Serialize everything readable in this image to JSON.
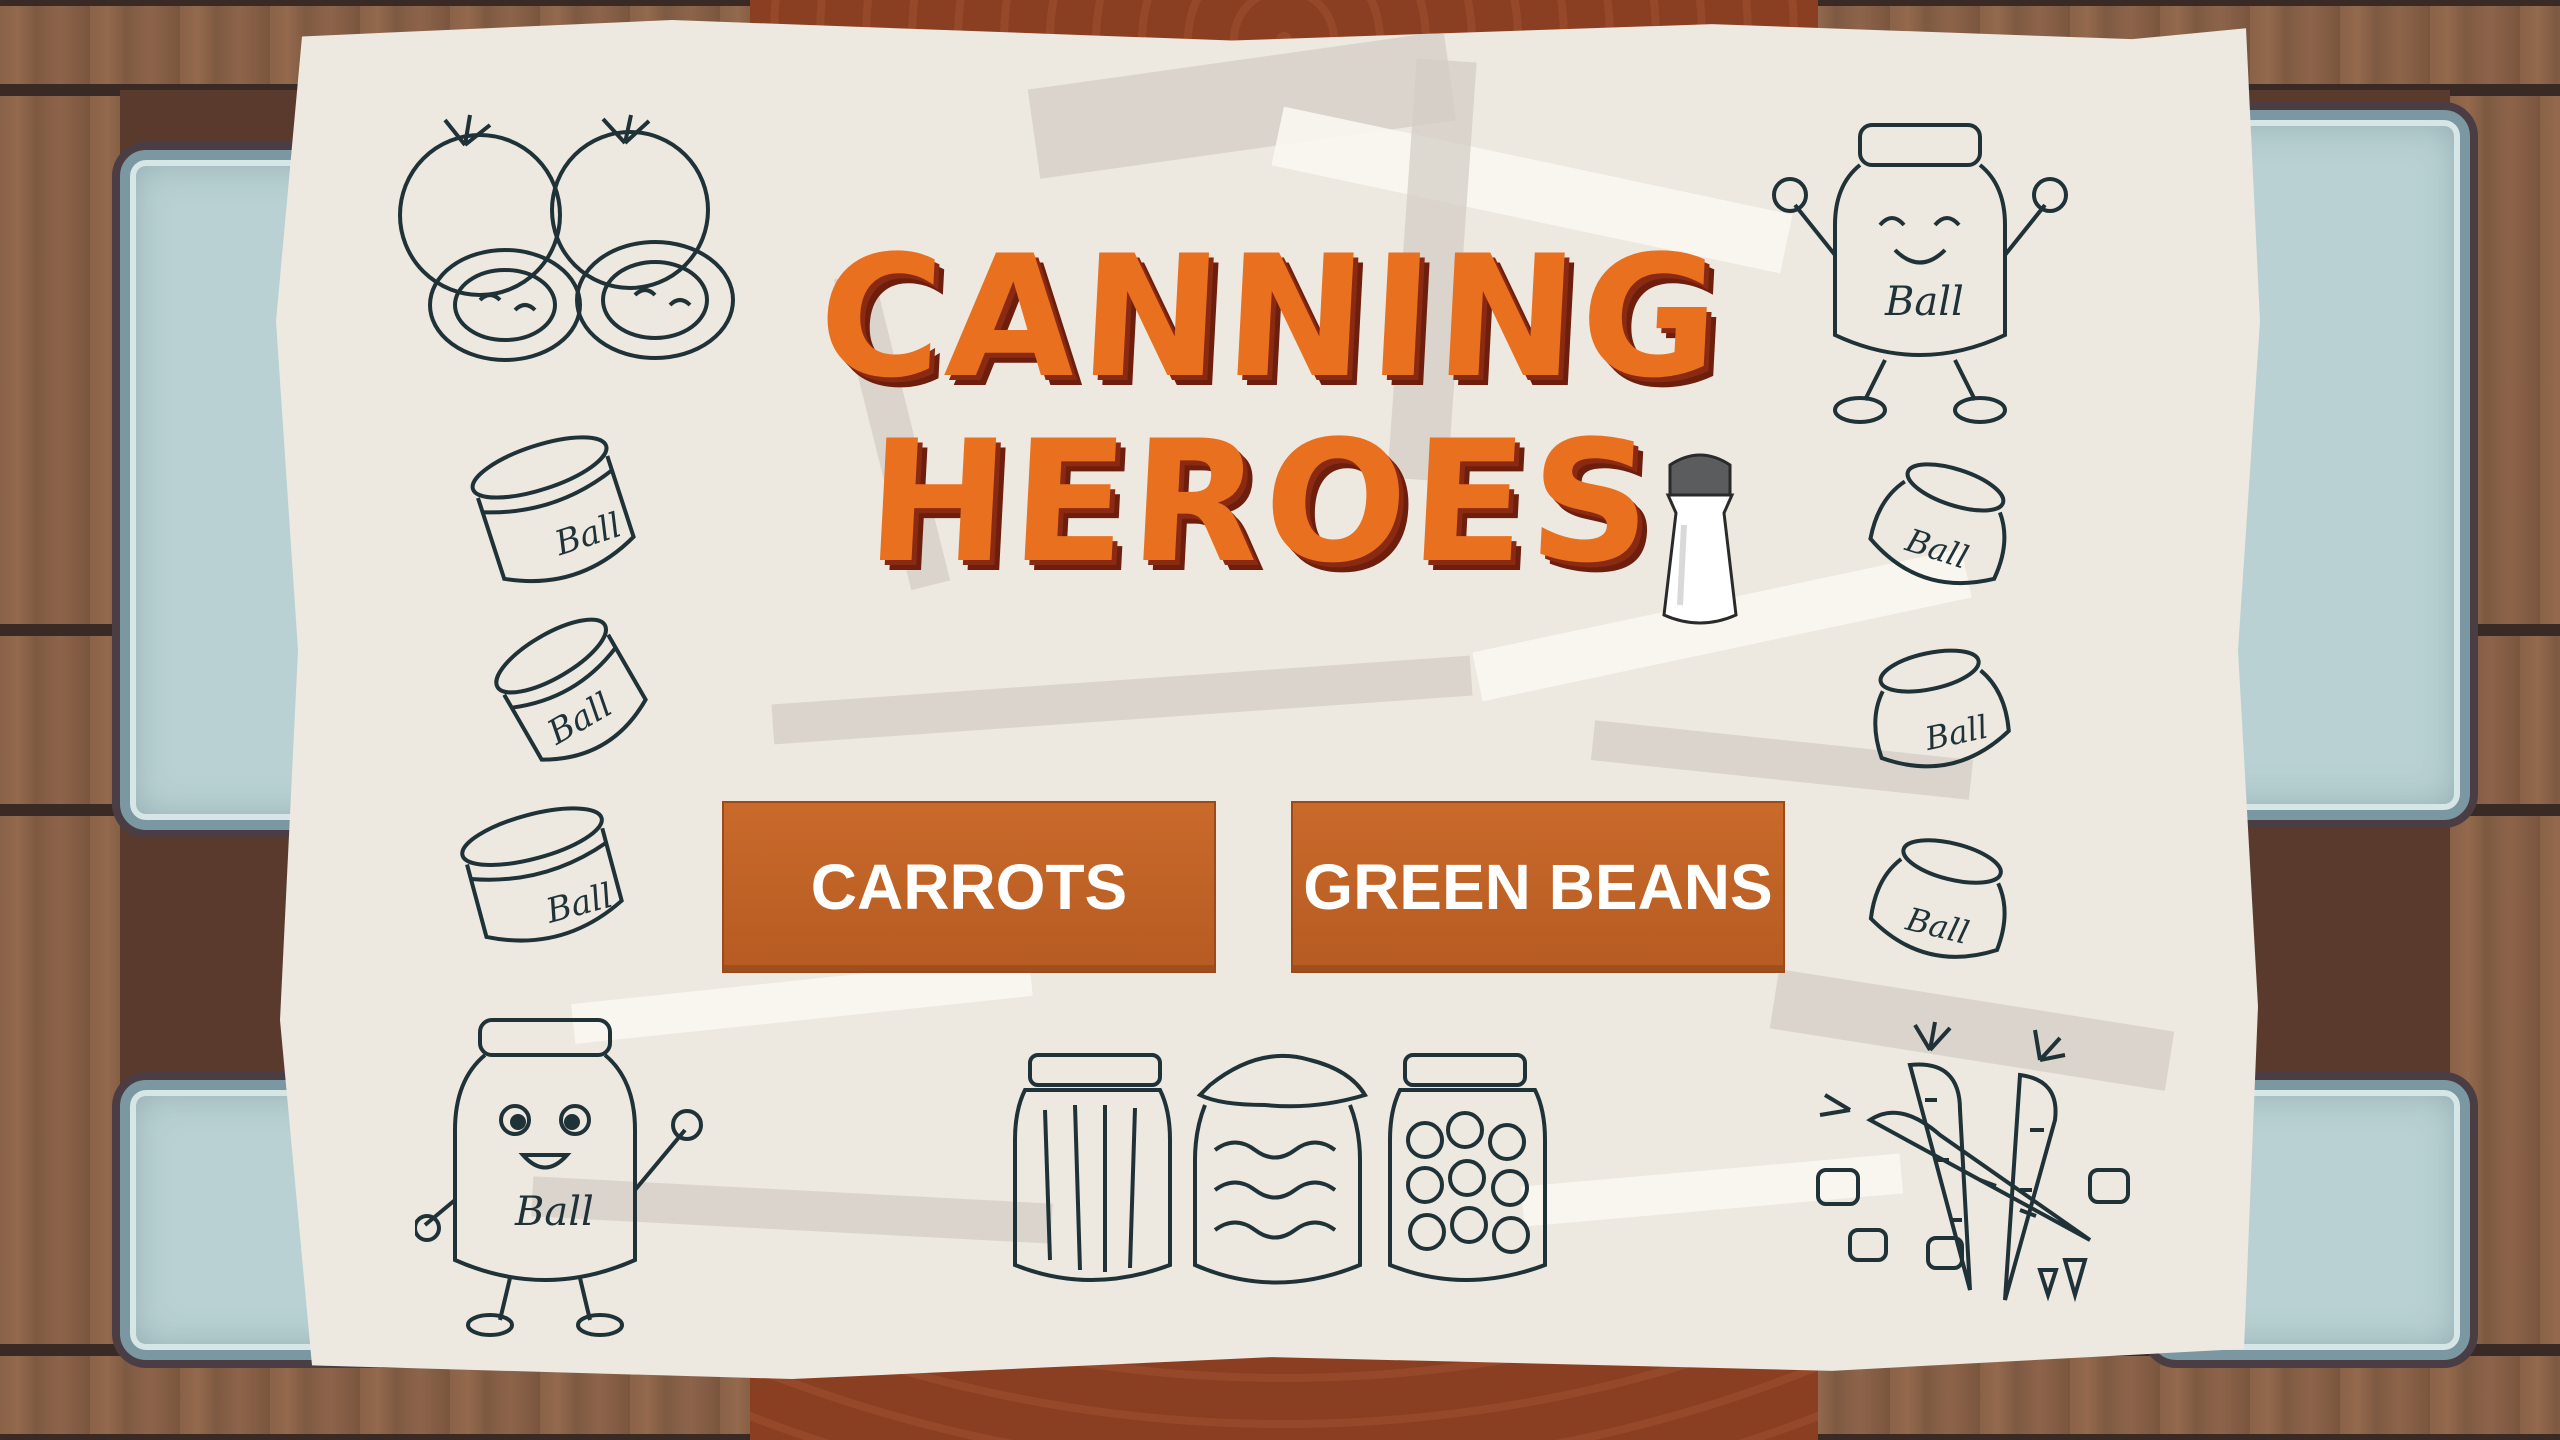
{
  "game": {
    "title_line1": "CANNING",
    "title_line2": "HEROES"
  },
  "menu": {
    "buttons": [
      {
        "label": "CARROTS"
      },
      {
        "label": "GREEN BEANS"
      }
    ]
  },
  "decor": {
    "jar_brand": "Ball",
    "icons": [
      "tomatoes-icon",
      "mason-jar-icon",
      "happy-jar-character-icon",
      "waving-jar-character-icon",
      "pickle-jars-icon",
      "carrots-icon",
      "salt-shaker-icon"
    ]
  },
  "colors": {
    "title_orange": "#e8701f",
    "title_shadow": "#8a2a12",
    "button_fill": "#c2642a",
    "ink": "#1f3238",
    "paper": "#ede8e0"
  }
}
